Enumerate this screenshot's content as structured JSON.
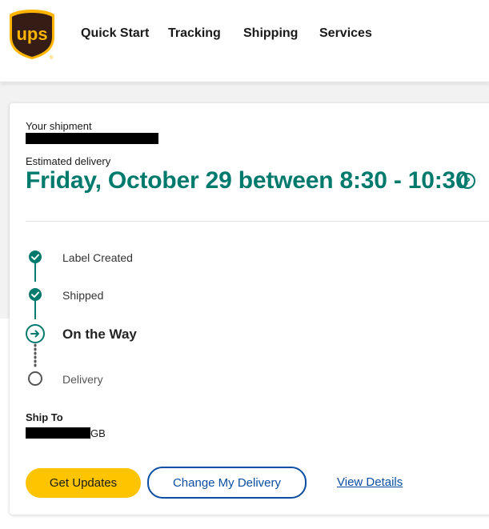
{
  "header": {
    "logo_text": "ups",
    "nav": [
      {
        "label": "Quick Start"
      },
      {
        "label": "Tracking"
      },
      {
        "label": "Shipping"
      },
      {
        "label": "Services"
      }
    ]
  },
  "shipment": {
    "your_shipment_label": "Your shipment",
    "estimated_label": "Estimated delivery",
    "estimated_value": "Friday, October 29 between 8:30 - 10:30",
    "help_icon": "question-circle-icon"
  },
  "progress": {
    "steps": [
      {
        "label": "Label Created",
        "state": "completed",
        "icon": "check-circle-icon"
      },
      {
        "label": "Shipped",
        "state": "completed",
        "icon": "check-circle-icon"
      },
      {
        "label": "On the Way",
        "state": "current",
        "icon": "arrow-circle-icon"
      },
      {
        "label": "Delivery",
        "state": "pending",
        "icon": "empty-circle-icon"
      }
    ]
  },
  "ship_to": {
    "label": "Ship To",
    "country": "GB"
  },
  "actions": {
    "get_updates": "Get Updates",
    "change_delivery": "Change My Delivery",
    "view_details": "View Details"
  },
  "colors": {
    "brand_brown": "#351c15",
    "brand_gold": "#ffb500",
    "teal": "#007a6c",
    "button_yellow": "#ffc400",
    "link_blue": "#0b4ea2"
  }
}
